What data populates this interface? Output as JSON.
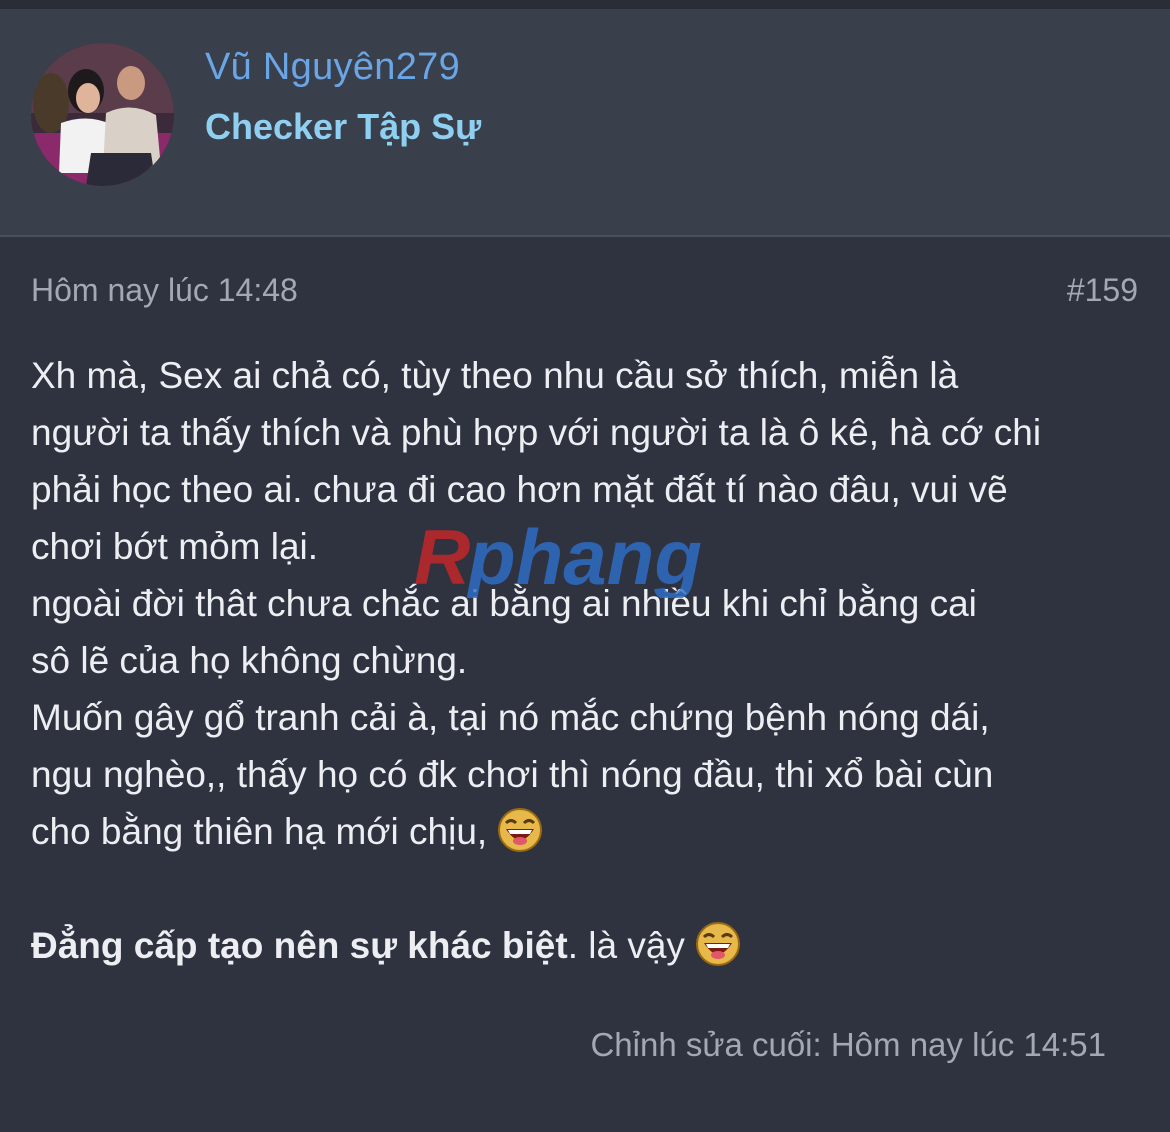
{
  "user": {
    "name": "Vũ Nguyên279",
    "title": "Checker Tập Sự",
    "avatar_icon": "user-avatar-photo"
  },
  "post": {
    "time": "Hôm nay lúc 14:48",
    "number": "#159",
    "lines": [
      "Xh mà, Sex ai chả có, tùy theo nhu cầu sở thích, miễn là",
      "người ta thấy thích và phù hợp với người ta là ô kê, hà cớ chi",
      "phải học theo ai. chưa đi cao hơn mặt đất tí nào đâu, vui vẽ",
      "chơi bớt mỏm lại.",
      "ngoài đời thât chưa chắc ai bằng ai nhiều khi chỉ bằng cai",
      "sô lẽ của họ không chừng.",
      "Muốn gây gổ tranh cải à, tại nó mắc chứng bệnh nóng dái,",
      "ngu nghèo,, thấy họ có đk chơi thì nóng đầu, thi xổ bài cùn",
      "cho bằng thiên hạ mới chịu,"
    ],
    "closing_bold": "Đẳng cấp tạo nên sự khác biệt",
    "closing_rest": ". là vậy",
    "emoji_icon": "laughing-emoji-icon",
    "edit_note": "Chỉnh sửa cuối: Hôm nay lúc 14:51"
  },
  "watermark": {
    "text": "Rphang",
    "colors": {
      "r": "#c8262a",
      "rest": "#2f6fc9"
    }
  },
  "colors": {
    "background": "#2f3340",
    "header_bg": "#3a3f4c",
    "username": "#6aa6e6",
    "user_title": "#8fd0f2",
    "body_text": "#eceef2",
    "meta_text": "#a3a8b3"
  }
}
